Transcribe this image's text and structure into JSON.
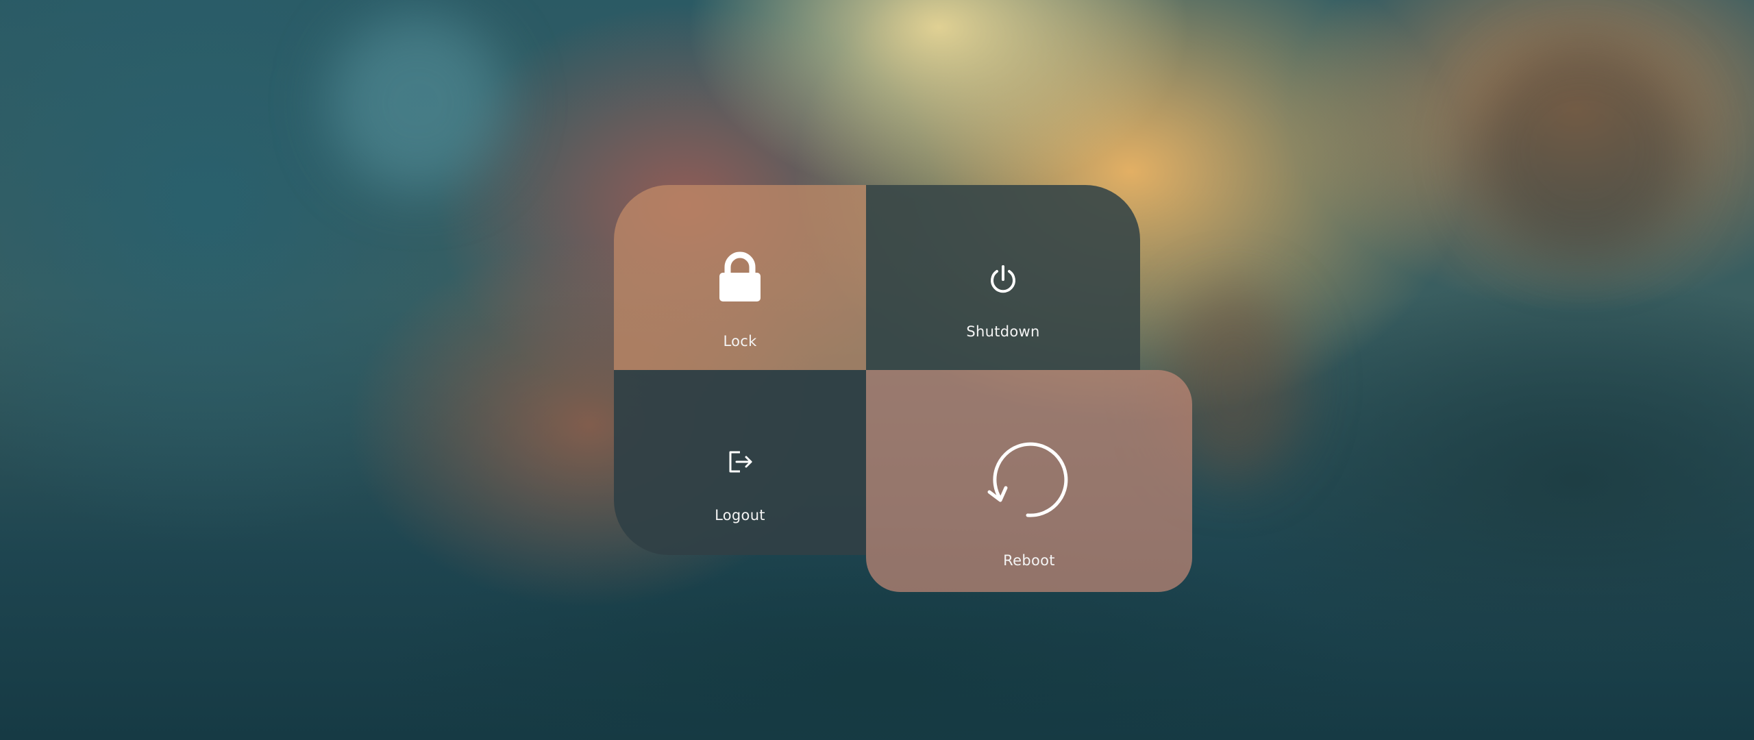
{
  "power_menu": {
    "options": [
      {
        "id": "lock",
        "label": "Lock",
        "icon": "lock-icon"
      },
      {
        "id": "shutdown",
        "label": "Shutdown",
        "icon": "power-icon"
      },
      {
        "id": "logout",
        "label": "Logout",
        "icon": "logout-icon"
      },
      {
        "id": "reboot",
        "label": "Reboot",
        "icon": "reboot-icon"
      }
    ],
    "active_option": "reboot"
  },
  "colors": {
    "accent_tile": "#c28c68",
    "dark_tile": "#304046",
    "text": "#ffffff"
  }
}
